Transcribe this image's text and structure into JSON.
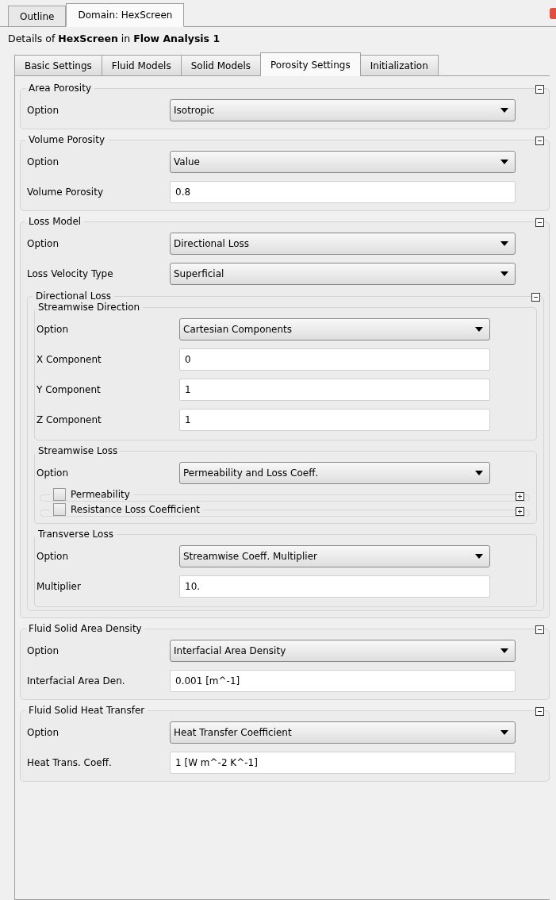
{
  "outer_tabs": [
    {
      "label": "Outline",
      "selected": false
    },
    {
      "label": "Domain: HexScreen",
      "selected": true
    }
  ],
  "details": "Details of **HexScreen** in **Flow Analysis 1**",
  "tabs": [
    {
      "label": "Basic Settings",
      "selected": false
    },
    {
      "label": "Fluid Models",
      "selected": false
    },
    {
      "label": "Solid Models",
      "selected": false
    },
    {
      "label": "Porosity Settings",
      "selected": true
    },
    {
      "label": "Initialization",
      "selected": false
    }
  ],
  "groups": [
    {
      "title": "Area Porosity",
      "expanded": true,
      "rows": [
        {
          "kind": "select",
          "label": "Option",
          "value": "Isotropic"
        }
      ]
    },
    {
      "title": "Volume Porosity",
      "expanded": true,
      "rows": [
        {
          "kind": "select",
          "label": "Option",
          "value": "Value"
        },
        {
          "kind": "text",
          "label": "Volume Porosity",
          "value": "0.8"
        }
      ]
    },
    {
      "title": "Loss Model",
      "expanded": true,
      "rows": [
        {
          "kind": "select",
          "label": "Option",
          "value": "Directional Loss"
        },
        {
          "kind": "select",
          "label": "Loss Velocity Type",
          "value": "Superficial"
        },
        {
          "kind": "group",
          "title": "Directional Loss",
          "expanded": true,
          "rows": [
            {
              "kind": "section",
              "title": "Streamwise Direction",
              "rows": [
                {
                  "kind": "select",
                  "label": "Option",
                  "value": "Cartesian Components"
                },
                {
                  "kind": "text",
                  "label": "X Component",
                  "value": "0"
                },
                {
                  "kind": "text",
                  "label": "Y Component",
                  "value": "1"
                },
                {
                  "kind": "text",
                  "label": "Z Component",
                  "value": "1"
                }
              ]
            },
            {
              "kind": "section",
              "title": "Streamwise Loss",
              "rows": [
                {
                  "kind": "select",
                  "label": "Option",
                  "value": "Permeability and Loss Coeff."
                },
                {
                  "kind": "check",
                  "label": "Permeability",
                  "checked": false,
                  "expanded": false
                },
                {
                  "kind": "check",
                  "label": "Resistance Loss Coefficient",
                  "checked": false,
                  "expanded": false
                }
              ]
            },
            {
              "kind": "section",
              "title": "Transverse Loss",
              "rows": [
                {
                  "kind": "select",
                  "label": "Option",
                  "value": "Streamwise Coeff. Multiplier"
                },
                {
                  "kind": "text",
                  "label": "Multiplier",
                  "value": "10."
                }
              ]
            }
          ]
        }
      ]
    },
    {
      "title": "Fluid Solid Area Density",
      "expanded": true,
      "rows": [
        {
          "kind": "select",
          "label": "Option",
          "value": "Interfacial Area Density"
        },
        {
          "kind": "text",
          "label": "Interfacial Area Den.",
          "value": "0.001 [m^-1]"
        }
      ]
    },
    {
      "title": "Fluid Solid Heat Transfer",
      "expanded": true,
      "rows": [
        {
          "kind": "select",
          "label": "Option",
          "value": "Heat Transfer Coefficient"
        },
        {
          "kind": "text",
          "label": "Heat Trans. Coeff.",
          "value": "1 [W m^-2 K^-1]"
        }
      ]
    }
  ]
}
